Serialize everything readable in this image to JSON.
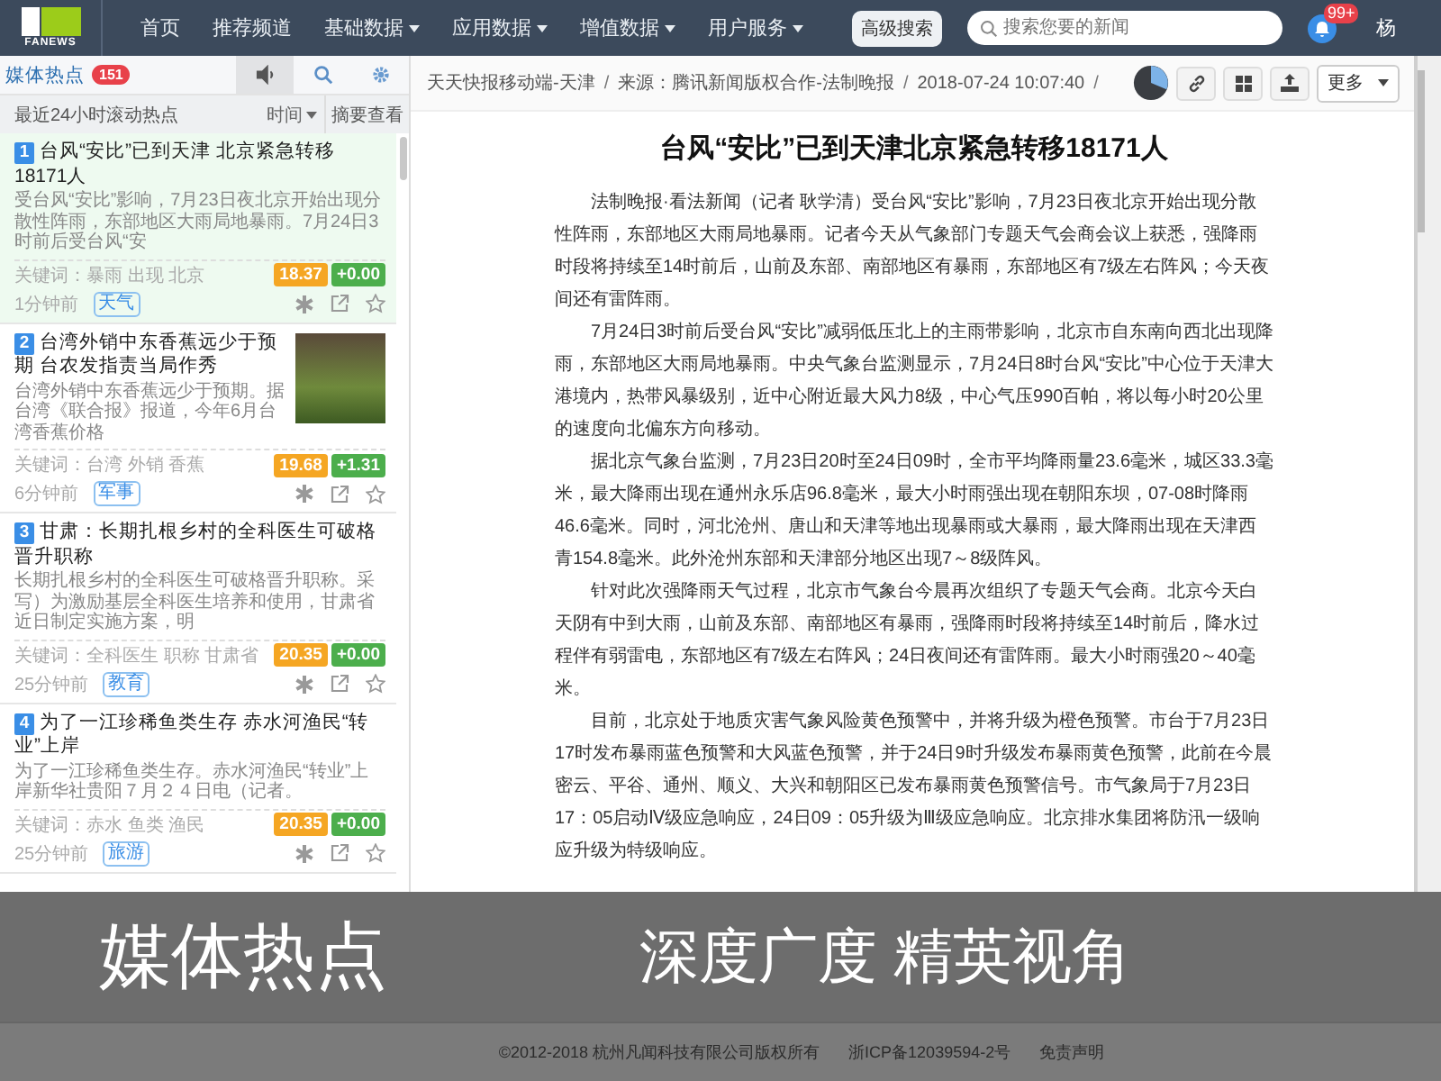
{
  "nav": {
    "logo_text": "FANEWS",
    "items": [
      {
        "label": "首页",
        "dropdown": false
      },
      {
        "label": "推荐频道",
        "dropdown": false
      },
      {
        "label": "基础数据",
        "dropdown": true
      },
      {
        "label": "应用数据",
        "dropdown": true
      },
      {
        "label": "增值数据",
        "dropdown": true
      },
      {
        "label": "用户服务",
        "dropdown": true
      }
    ],
    "advanced_search": "高级搜索",
    "search": {
      "placeholder": "搜索您要的新闻"
    },
    "notifications": "99+",
    "user": "杨"
  },
  "sidebar": {
    "title": "媒体热点",
    "count": "151",
    "subtitle": "最近24小时滚动热点",
    "sort": "时间",
    "summary_toggle": "摘要查看",
    "items": [
      {
        "num": "1",
        "title": "台风“安比”已到天津 北京紧急转移18171人",
        "summary": "受台风“安比”影响，7月23日夜北京开始出现分散性阵雨，东部地区大雨局地暴雨。7月24日3时前后受台风“安",
        "keywords": "关键词：暴雨 出现 北京",
        "score": "18.37",
        "delta": "+0.00",
        "time": "1分钟前",
        "tag": "天气",
        "photo": false,
        "selected": true
      },
      {
        "num": "2",
        "title": "台湾外销中东香蕉远少于预期 台农发指责当局作秀",
        "summary": "台湾外销中东香蕉远少于预期。据台湾《联合报》报道，今年6月台湾香蕉价格",
        "keywords": "关键词：台湾 外销 香蕉",
        "score": "19.68",
        "delta": "+1.31",
        "time": "6分钟前",
        "tag": "军事",
        "photo": true,
        "selected": false
      },
      {
        "num": "3",
        "title": "甘肃：长期扎根乡村的全科医生可破格晋升职称",
        "summary": "长期扎根乡村的全科医生可破格晋升职称。采写）为激励基层全科医生培养和使用，甘肃省近日制定实施方案，明",
        "keywords": "关键词：全科医生 职称 甘肃省",
        "score": "20.35",
        "delta": "+0.00",
        "time": "25分钟前",
        "tag": "教育",
        "photo": false,
        "selected": false
      },
      {
        "num": "4",
        "title": "为了一江珍稀鱼类生存 赤水河渔民“转业”上岸",
        "summary": "为了一江珍稀鱼类生存。赤水河渔民“转业”上岸新华社贵阳７月２４日电（记者。",
        "keywords": "关键词：赤水 鱼类 渔民",
        "score": "20.35",
        "delta": "+0.00",
        "time": "25分钟前",
        "tag": "旅游",
        "photo": false,
        "selected": false
      }
    ]
  },
  "article": {
    "meta": [
      "天天快报移动端-天津",
      "/",
      "来源：腾讯新闻版权合作-法制晚报",
      "/",
      "2018-07-24 10:07:40",
      "/"
    ],
    "more": "更多",
    "title": "台风“安比”已到天津北京紧急转移18171人",
    "paragraphs": [
      "法制晚报·看法新闻（记者 耿学清）受台风“安比”影响，7月23日夜北京开始出现分散性阵雨，东部地区大雨局地暴雨。记者今天从气象部门专题天气会商会议上获悉，强降雨时段将持续至14时前后，山前及东部、南部地区有暴雨，东部地区有7级左右阵风；今天夜间还有雷阵雨。",
      "7月24日3时前后受台风“安比”减弱低压北上的主雨带影响，北京市自东南向西北出现降雨，东部地区大雨局地暴雨。中央气象台监测显示，7月24日8时台风“安比”中心位于天津大港境内，热带风暴级别，近中心附近最大风力8级，中心气压990百帕，将以每小时20公里的速度向北偏东方向移动。",
      "据北京气象台监测，7月23日20时至24日09时，全市平均降雨量23.6毫米，城区33.3毫米，最大降雨出现在通州永乐店96.8毫米，最大小时雨强出现在朝阳东坝，07-08时降雨46.6毫米。同时，河北沧州、唐山和天津等地出现暴雨或大暴雨，最大降雨出现在天津西青154.8毫米。此外沧州东部和天津部分地区出现7～8级阵风。",
      "针对此次强降雨天气过程，北京市气象台今晨再次组织了专题天气会商。北京今天白天阴有中到大雨，山前及东部、南部地区有暴雨，强降雨时段将持续至14时前后，降水过程伴有弱雷电，东部地区有7级左右阵风；24日夜间还有雷阵雨。最大小时雨强20～40毫米。",
      "目前，北京处于地质灾害气象风险黄色预警中，并将升级为橙色预警。市台于7月23日17时发布暴雨蓝色预警和大风蓝色预警，并于24日9时升级发布暴雨黄色预警，此前在今晨密云、平谷、通州、顺义、大兴和朝阳区已发布暴雨黄色预警信号。市气象局于7月23日17：05启动Ⅳ级应急响应，24日09：05升级为Ⅲ级应急响应。北京排水集团将防汛一级响应升级为特级响应。"
    ]
  },
  "banner": {
    "title": "媒体热点",
    "slogan": "深度广度 精英视角"
  },
  "footer": [
    "©2012-2018 杭州凡闻科技有限公司版权所有",
    "浙ICP备12039594-2号",
    "免责声明"
  ]
}
